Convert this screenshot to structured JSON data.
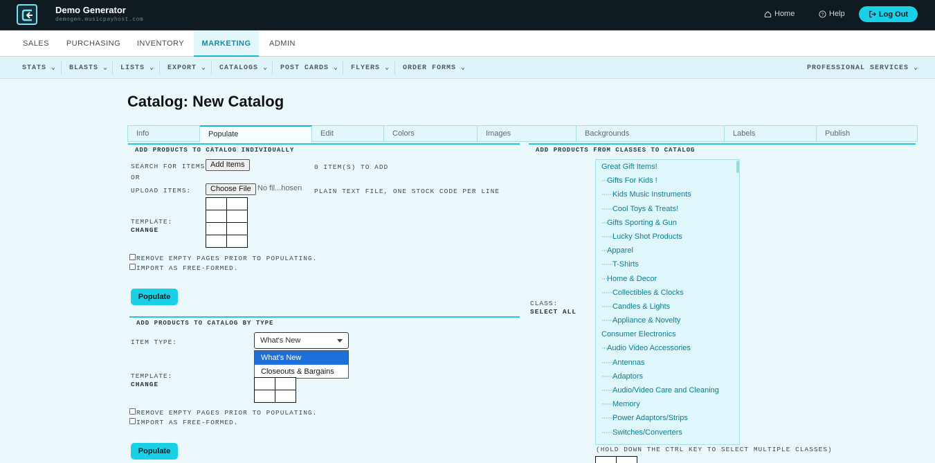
{
  "header": {
    "app_title": "Demo Generator",
    "app_subtitle": "demogen.musicpayhost.com",
    "home": "Home",
    "help": "Help",
    "logout": "Log Out"
  },
  "main_nav": [
    "SALES",
    "PURCHASING",
    "INVENTORY",
    "MARKETING",
    "ADMIN"
  ],
  "main_nav_active": "MARKETING",
  "sub_nav": [
    "STATS",
    "BLASTS",
    "LISTS",
    "EXPORT",
    "CATALOGS",
    "POST CARDS",
    "FLYERS",
    "ORDER FORMS",
    "PROFESSIONAL SERVICES"
  ],
  "page_title": "Catalog: New Catalog",
  "catalog_tabs": [
    "Info",
    "Populate",
    "Edit",
    "Colors",
    "Images",
    "Backgrounds",
    "Labels",
    "Publish"
  ],
  "catalog_tab_active": "Populate",
  "individual": {
    "heading": "ADD PRODUCTS TO CATALOG INDIVIDUALLY",
    "search_label": "SEARCH FOR ITEMS:",
    "add_items_button": "Add Items",
    "count_text": "0 ITEM(S) TO ADD",
    "or_text": "OR",
    "upload_label": "UPLOAD ITEMS:",
    "choose_file_button": "Choose File",
    "no_file_text": "No fil...hosen",
    "upload_hint": "PLAIN TEXT FILE, ONE STOCK CODE PER LINE",
    "template_label": "TEMPLATE:",
    "change_link": "CHANGE",
    "remove_empty_label": "REMOVE EMPTY PAGES PRIOR TO POPULATING.",
    "import_free_label": "IMPORT AS FREE-FORMED.",
    "populate_button": "Populate"
  },
  "by_type": {
    "heading": "ADD PRODUCTS TO CATALOG BY TYPE",
    "item_type_label": "ITEM TYPE:",
    "selected": "What's New",
    "options": [
      "What's New",
      "Closeouts & Bargains"
    ],
    "template_label": "TEMPLATE:",
    "change_link": "CHANGE",
    "remove_empty_label": "REMOVE EMPTY PAGES PRIOR TO POPULATING.",
    "import_free_label": "IMPORT AS FREE-FORMED.",
    "populate_button": "Populate"
  },
  "classes": {
    "heading": "ADD PRODUCTS FROM CLASSES TO CATALOG",
    "class_label": "CLASS:",
    "select_all": "SELECT ALL",
    "hint": "(HOLD DOWN THE CTRL KEY TO SELECT MULTIPLE CLASSES)",
    "items": [
      {
        "indent": "",
        "label": "Great Gift Items!"
      },
      {
        "indent": "···",
        "label": "Gifts For Kids !"
      },
      {
        "indent": "······",
        "label": "Kids Music Instruments"
      },
      {
        "indent": "······",
        "label": "Cool Toys & Treats!"
      },
      {
        "indent": "···",
        "label": "Gifts Sporting & Gun"
      },
      {
        "indent": "······",
        "label": "Lucky Shot Products"
      },
      {
        "indent": "···",
        "label": "Apparel"
      },
      {
        "indent": "······",
        "label": "T-Shirts"
      },
      {
        "indent": "···",
        "label": "Home & Decor"
      },
      {
        "indent": "······",
        "label": "Collectibles & Clocks"
      },
      {
        "indent": "······",
        "label": "Candles & Lights"
      },
      {
        "indent": "······",
        "label": "Appliance & Novelty"
      },
      {
        "indent": "",
        "label": "Consumer Electronics"
      },
      {
        "indent": "···",
        "label": "Audio Video Accessories"
      },
      {
        "indent": "······",
        "label": "Antennas"
      },
      {
        "indent": "······",
        "label": "Adaptors"
      },
      {
        "indent": "······",
        "label": "Audio/Video Care and Cleaning"
      },
      {
        "indent": "······",
        "label": "Memory"
      },
      {
        "indent": "······",
        "label": "Power Adaptors/Strips"
      },
      {
        "indent": "······",
        "label": "Switches/Converters"
      }
    ]
  },
  "colors": {
    "accent": "#19d0e6",
    "header_bg": "#0f1b21",
    "link": "#0a7d90"
  }
}
